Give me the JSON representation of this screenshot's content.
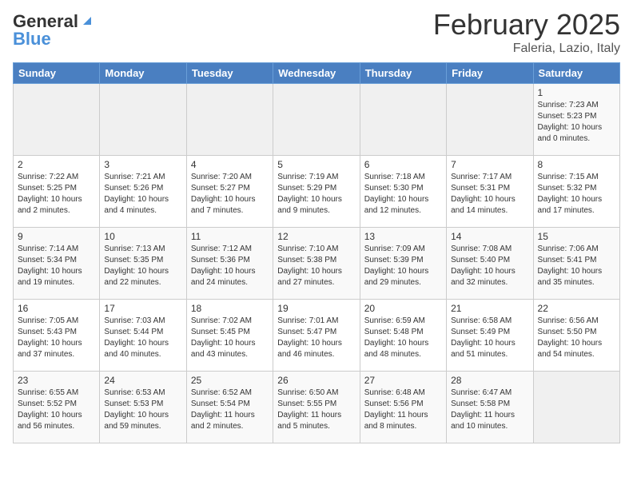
{
  "header": {
    "logo_general": "General",
    "logo_blue": "Blue",
    "month_year": "February 2025",
    "location": "Faleria, Lazio, Italy"
  },
  "weekdays": [
    "Sunday",
    "Monday",
    "Tuesday",
    "Wednesday",
    "Thursday",
    "Friday",
    "Saturday"
  ],
  "weeks": [
    [
      {
        "day": "",
        "info": ""
      },
      {
        "day": "",
        "info": ""
      },
      {
        "day": "",
        "info": ""
      },
      {
        "day": "",
        "info": ""
      },
      {
        "day": "",
        "info": ""
      },
      {
        "day": "",
        "info": ""
      },
      {
        "day": "1",
        "info": "Sunrise: 7:23 AM\nSunset: 5:23 PM\nDaylight: 10 hours\nand 0 minutes."
      }
    ],
    [
      {
        "day": "2",
        "info": "Sunrise: 7:22 AM\nSunset: 5:25 PM\nDaylight: 10 hours\nand 2 minutes."
      },
      {
        "day": "3",
        "info": "Sunrise: 7:21 AM\nSunset: 5:26 PM\nDaylight: 10 hours\nand 4 minutes."
      },
      {
        "day": "4",
        "info": "Sunrise: 7:20 AM\nSunset: 5:27 PM\nDaylight: 10 hours\nand 7 minutes."
      },
      {
        "day": "5",
        "info": "Sunrise: 7:19 AM\nSunset: 5:29 PM\nDaylight: 10 hours\nand 9 minutes."
      },
      {
        "day": "6",
        "info": "Sunrise: 7:18 AM\nSunset: 5:30 PM\nDaylight: 10 hours\nand 12 minutes."
      },
      {
        "day": "7",
        "info": "Sunrise: 7:17 AM\nSunset: 5:31 PM\nDaylight: 10 hours\nand 14 minutes."
      },
      {
        "day": "8",
        "info": "Sunrise: 7:15 AM\nSunset: 5:32 PM\nDaylight: 10 hours\nand 17 minutes."
      }
    ],
    [
      {
        "day": "9",
        "info": "Sunrise: 7:14 AM\nSunset: 5:34 PM\nDaylight: 10 hours\nand 19 minutes."
      },
      {
        "day": "10",
        "info": "Sunrise: 7:13 AM\nSunset: 5:35 PM\nDaylight: 10 hours\nand 22 minutes."
      },
      {
        "day": "11",
        "info": "Sunrise: 7:12 AM\nSunset: 5:36 PM\nDaylight: 10 hours\nand 24 minutes."
      },
      {
        "day": "12",
        "info": "Sunrise: 7:10 AM\nSunset: 5:38 PM\nDaylight: 10 hours\nand 27 minutes."
      },
      {
        "day": "13",
        "info": "Sunrise: 7:09 AM\nSunset: 5:39 PM\nDaylight: 10 hours\nand 29 minutes."
      },
      {
        "day": "14",
        "info": "Sunrise: 7:08 AM\nSunset: 5:40 PM\nDaylight: 10 hours\nand 32 minutes."
      },
      {
        "day": "15",
        "info": "Sunrise: 7:06 AM\nSunset: 5:41 PM\nDaylight: 10 hours\nand 35 minutes."
      }
    ],
    [
      {
        "day": "16",
        "info": "Sunrise: 7:05 AM\nSunset: 5:43 PM\nDaylight: 10 hours\nand 37 minutes."
      },
      {
        "day": "17",
        "info": "Sunrise: 7:03 AM\nSunset: 5:44 PM\nDaylight: 10 hours\nand 40 minutes."
      },
      {
        "day": "18",
        "info": "Sunrise: 7:02 AM\nSunset: 5:45 PM\nDaylight: 10 hours\nand 43 minutes."
      },
      {
        "day": "19",
        "info": "Sunrise: 7:01 AM\nSunset: 5:47 PM\nDaylight: 10 hours\nand 46 minutes."
      },
      {
        "day": "20",
        "info": "Sunrise: 6:59 AM\nSunset: 5:48 PM\nDaylight: 10 hours\nand 48 minutes."
      },
      {
        "day": "21",
        "info": "Sunrise: 6:58 AM\nSunset: 5:49 PM\nDaylight: 10 hours\nand 51 minutes."
      },
      {
        "day": "22",
        "info": "Sunrise: 6:56 AM\nSunset: 5:50 PM\nDaylight: 10 hours\nand 54 minutes."
      }
    ],
    [
      {
        "day": "23",
        "info": "Sunrise: 6:55 AM\nSunset: 5:52 PM\nDaylight: 10 hours\nand 56 minutes."
      },
      {
        "day": "24",
        "info": "Sunrise: 6:53 AM\nSunset: 5:53 PM\nDaylight: 10 hours\nand 59 minutes."
      },
      {
        "day": "25",
        "info": "Sunrise: 6:52 AM\nSunset: 5:54 PM\nDaylight: 11 hours\nand 2 minutes."
      },
      {
        "day": "26",
        "info": "Sunrise: 6:50 AM\nSunset: 5:55 PM\nDaylight: 11 hours\nand 5 minutes."
      },
      {
        "day": "27",
        "info": "Sunrise: 6:48 AM\nSunset: 5:56 PM\nDaylight: 11 hours\nand 8 minutes."
      },
      {
        "day": "28",
        "info": "Sunrise: 6:47 AM\nSunset: 5:58 PM\nDaylight: 11 hours\nand 10 minutes."
      },
      {
        "day": "",
        "info": ""
      }
    ]
  ]
}
